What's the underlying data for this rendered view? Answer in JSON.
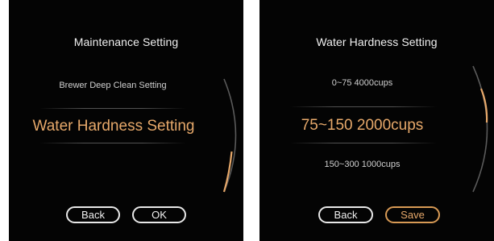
{
  "maintenance_screen": {
    "title": "Maintenance Setting",
    "option_above": "Brewer Deep Clean Setting",
    "option_selected": "Water Hardness Setting",
    "back_label": "Back",
    "ok_label": "OK"
  },
  "water_hardness_screen": {
    "title": "Water Hardness Setting",
    "option_above": "0~75 4000cups",
    "option_selected": "75~150 2000cups",
    "option_below": "150~300 1000cups",
    "back_label": "Back",
    "save_label": "Save"
  },
  "colors": {
    "screen_background": "#040404",
    "text": "#f0f0f0",
    "accent": "#e6a86a",
    "scroll_track": "#5a5a5a"
  },
  "scroll": {
    "maintenance_position_fraction": 0.85,
    "water_hardness_position_fraction": 0.45
  }
}
